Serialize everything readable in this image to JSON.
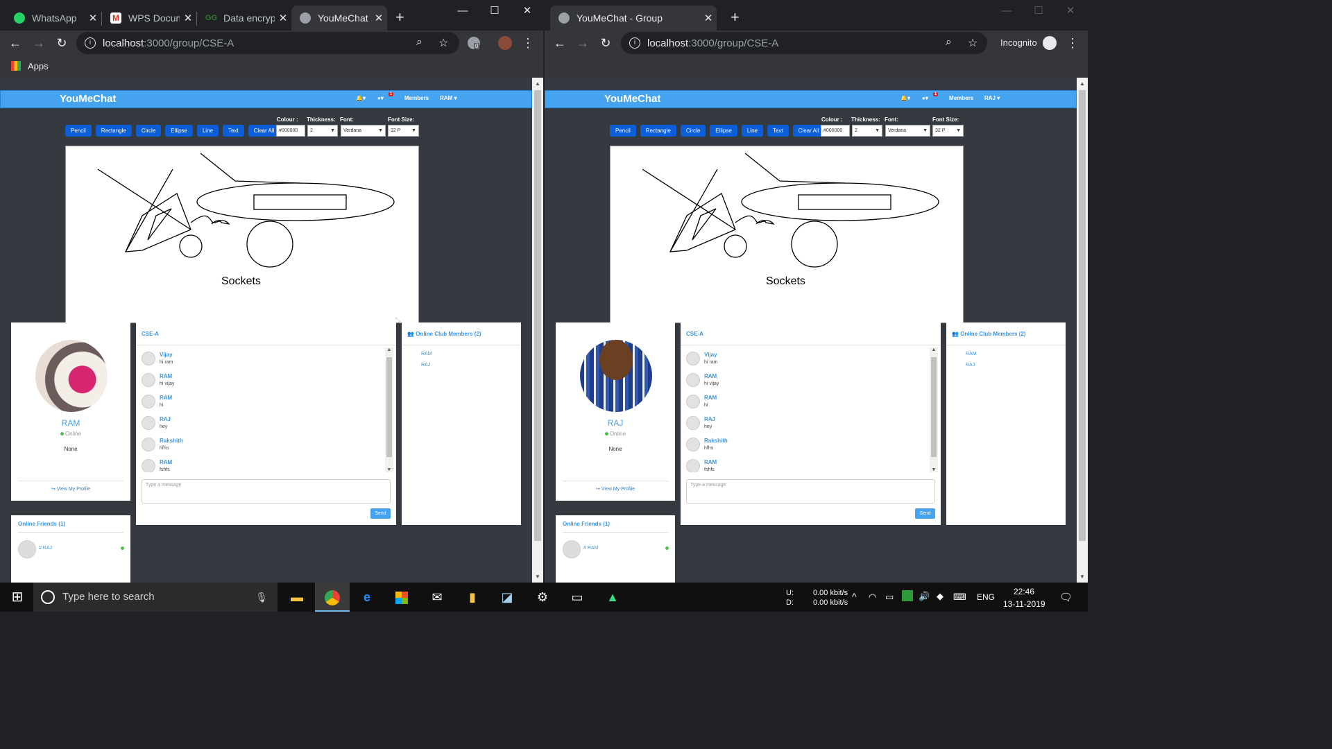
{
  "left_window": {
    "tabs": [
      {
        "title": "WhatsApp",
        "color": "#25d366"
      },
      {
        "title": "WPS Docume",
        "color": "#d93025"
      },
      {
        "title": "Data encrypt",
        "color": "#2e7d32"
      },
      {
        "title": "YouMeChat",
        "color": "#9aa0a6"
      }
    ],
    "url_host": "localhost",
    "url_path": ":3000/group/CSE-A",
    "bookmark": "Apps",
    "ext_badge": "0",
    "page": {
      "brand": "YouMeChat",
      "notif_badge": "1",
      "nav_members": "Members",
      "nav_user": "RAM",
      "tools": [
        "Pencil",
        "Rectangle",
        "Circle",
        "Ellipse",
        "Line",
        "Text",
        "Clear All"
      ],
      "colour_label": "Colour :",
      "colour_value": "#000000",
      "thickness_label": "Thickness:",
      "thickness_value": "2",
      "font_label": "Font:",
      "font_value": "Verdana",
      "fontsize_label": "Font Size:",
      "fontsize_value": "32 P",
      "canvas_text": "Sockets",
      "profile": {
        "name": "RAM",
        "status": "Online",
        "bio": "None",
        "view": "View My Profile",
        "avatar": "pink-cloth"
      },
      "chat": {
        "group": "CSE-A",
        "messages": [
          {
            "name": "Vijay",
            "text": "hi ram"
          },
          {
            "name": "RAM",
            "text": "hi vijay"
          },
          {
            "name": "RAM",
            "text": "hi"
          },
          {
            "name": "RAJ",
            "text": "hey"
          },
          {
            "name": "Rakshith",
            "text": "hfhs"
          },
          {
            "name": "RAM",
            "text": "fshfs"
          }
        ],
        "placeholder": "Type a message",
        "send": "Send"
      },
      "members": {
        "title": "Online Club Members (2)",
        "list": [
          "RAM",
          "RAJ"
        ]
      },
      "friends": {
        "title": "Online Friends (1)",
        "name": "# RAJ"
      }
    }
  },
  "right_window": {
    "tabs": [
      {
        "title": "YouMeChat - Group",
        "color": "#9aa0a6"
      }
    ],
    "url_host": "localhost",
    "url_path": ":3000/group/CSE-A",
    "incognito": "Incognito",
    "page": {
      "brand": "YouMeChat",
      "notif_badge": "1",
      "nav_members": "Members",
      "nav_user": "RAJ",
      "tools": [
        "Pencil",
        "Rectangle",
        "Circle",
        "Ellipse",
        "Line",
        "Text",
        "Clear All"
      ],
      "colour_label": "Colour :",
      "colour_value": "#000000",
      "thickness_label": "Thickness:",
      "thickness_value": "2",
      "font_label": "Font:",
      "font_value": "Verdana",
      "fontsize_label": "Font Size:",
      "fontsize_value": "32 P",
      "canvas_text": "Sockets",
      "profile": {
        "name": "RAJ",
        "status": "Online",
        "bio": "None",
        "view": "View My Profile",
        "avatar": "man-photo"
      },
      "chat": {
        "group": "CSE-A",
        "messages": [
          {
            "name": "Vijay",
            "text": "hi ram"
          },
          {
            "name": "RAM",
            "text": "hi vijay"
          },
          {
            "name": "RAM",
            "text": "hi"
          },
          {
            "name": "RAJ",
            "text": "hey"
          },
          {
            "name": "Rakshith",
            "text": "hfhs"
          },
          {
            "name": "RAM",
            "text": "fshfs"
          }
        ],
        "placeholder": "Type a message",
        "send": "Send"
      },
      "members": {
        "title": "Online Club Members (2)",
        "list": [
          "RAM",
          "RAJ"
        ]
      },
      "friends": {
        "title": "Online Friends (1)",
        "name": "# RAM"
      }
    }
  },
  "taskbar": {
    "search_placeholder": "Type here to search",
    "net_up_label": "U:",
    "net_down_label": "D:",
    "net_up": "0.00 kbit/s",
    "net_down": "0.00 kbit/s",
    "lang": "ENG",
    "time": "22:46",
    "date": "13-11-2019",
    "apps": [
      "file-explorer-icon",
      "chrome-icon",
      "edge-icon",
      "store-icon",
      "mail-icon",
      "sticky-notes-icon",
      "snip-icon",
      "settings-gear-icon",
      "terminal-icon",
      "android-studio-icon"
    ]
  }
}
